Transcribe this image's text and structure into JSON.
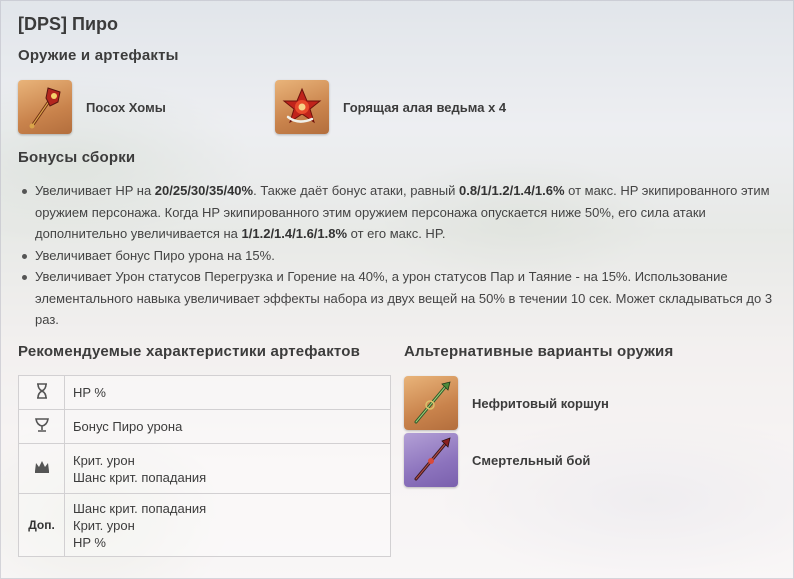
{
  "title": "[DPS] Пиро",
  "weapons_section": {
    "heading": "Оружие и артефакты",
    "weapon": {
      "name": "Посох Хомы",
      "icon": "homa-staff-icon"
    },
    "artifact": {
      "name": "Горящая алая ведьма х 4",
      "icon": "crimson-witch-icon"
    }
  },
  "bonus_section": {
    "heading": "Бонусы сборки",
    "items": [
      {
        "t1": "Увеличивает HP на ",
        "b1": "20/25/30/35/40%",
        "t2": ". Также даёт бонус атаки, равный ",
        "b2": "0.8/1/1.2/1.4/1.6%",
        "t3": " от макс. HP экипированного этим оружием персонажа. Когда HP экипированного этим оружием персонажа опускается ниже 50%, его сила атаки дополнительно увеличивается на ",
        "b3": "1/1.2/1.4/1.6/1.8%",
        "t4": " от его макс. HP."
      },
      {
        "text": "Увеличивает бонус Пиро урона на 15%."
      },
      {
        "text": "Увеличивает Урон статусов Перегрузка и Горение на 40%, а урон статусов Пар и Таяние - на 15%. Использование элементального навыка увеличивает эффекты набора из двух вещей на 50% в течении 10 сек. Может складываться до 3 раз."
      }
    ]
  },
  "stats_section": {
    "heading": "Рекомендуемые характеристики артефактов",
    "rows": [
      {
        "icon": "hourglass-icon",
        "lines": [
          "HP %"
        ]
      },
      {
        "icon": "goblet-icon",
        "lines": [
          "Бонус Пиро урона"
        ]
      },
      {
        "icon": "circlet-icon",
        "lines": [
          "Крит. урон",
          "Шанс крит. попадания"
        ]
      },
      {
        "label": "Доп.",
        "lines": [
          "Шанс крит. попадания",
          "Крит. урон",
          "HP %"
        ]
      }
    ]
  },
  "alt_section": {
    "heading": "Альтернативные варианты оружия",
    "items": [
      {
        "name": "Нефритовый коршун",
        "icon": "jade-spear-icon",
        "rarity_color": "#c9834c"
      },
      {
        "name": "Смертельный бой",
        "icon": "deathmatch-icon",
        "rarity_color": "#8c73bd"
      }
    ]
  }
}
